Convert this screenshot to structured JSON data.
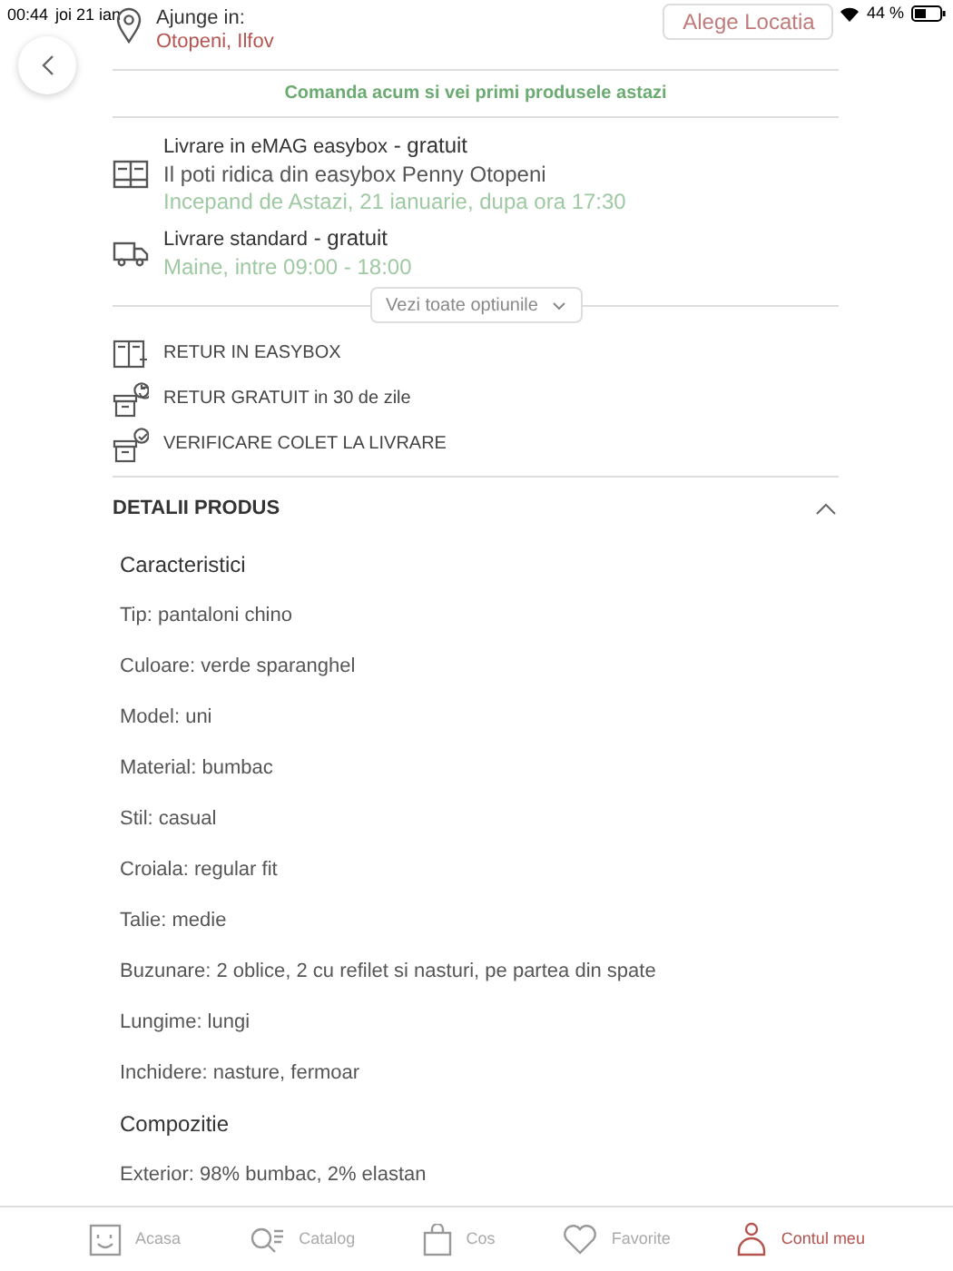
{
  "status_bar": {
    "time": "00:44",
    "date": "joi 21 ian",
    "battery": "44 %"
  },
  "location": {
    "label": "Ajunge in:",
    "place": "Otopeni, Ilfov",
    "button": "Alege Locatia"
  },
  "promo": "Comanda acum si vei primi produsele astazi",
  "delivery_options": [
    {
      "kind": "easybox",
      "title": "Livrare in eMAG easybox",
      "price": " - gratuit",
      "detail": "Il poti ridica din easybox Penny Otopeni",
      "timing": "Incepand de Astazi, 21 ianuarie, dupa ora 17:30"
    },
    {
      "kind": "truck",
      "title": "Livrare standard",
      "price": " - gratuit",
      "timing": "Maine, intre 09:00 - 18:00"
    }
  ],
  "more_options": "Vezi toate optiunile",
  "benefits": [
    {
      "kind": "locker",
      "text": "RETUR IN EASYBOX"
    },
    {
      "kind": "return",
      "text": "RETUR GRATUIT in 30 de zile"
    },
    {
      "kind": "check",
      "text": "VERIFICARE COLET LA LIVRARE"
    }
  ],
  "details": {
    "title": "DETALII PRODUS",
    "expanded": true,
    "items": [
      {
        "kind": "heading",
        "text": "Caracteristici"
      },
      {
        "kind": "spec",
        "text": "Tip: pantaloni chino"
      },
      {
        "kind": "spec",
        "text": "Culoare: verde sparanghel"
      },
      {
        "kind": "spec",
        "text": "Model: uni"
      },
      {
        "kind": "spec",
        "text": "Material: bumbac"
      },
      {
        "kind": "spec",
        "text": "Stil: casual"
      },
      {
        "kind": "spec",
        "text": "Croiala: regular fit"
      },
      {
        "kind": "spec",
        "text": "Talie: medie"
      },
      {
        "kind": "spec",
        "text": "Buzunare: 2 oblice, 2 cu refilet si nasturi, pe partea din spate"
      },
      {
        "kind": "spec",
        "text": "Lungime: lungi"
      },
      {
        "kind": "spec",
        "text": "Inchidere: nasture, fermoar"
      },
      {
        "kind": "heading",
        "text": "Compozitie"
      },
      {
        "kind": "spec",
        "text": "Exterior: 98% bumbac, 2% elastan"
      }
    ]
  },
  "tab_bar": [
    {
      "kind": "home",
      "label": "Acasa",
      "selected": false
    },
    {
      "kind": "catalog",
      "label": "Catalog",
      "selected": false
    },
    {
      "kind": "cart",
      "label": "Cos",
      "selected": false
    },
    {
      "kind": "favorites",
      "label": "Favorite",
      "selected": false
    },
    {
      "kind": "account",
      "label": "Contul meu",
      "selected": true
    }
  ]
}
